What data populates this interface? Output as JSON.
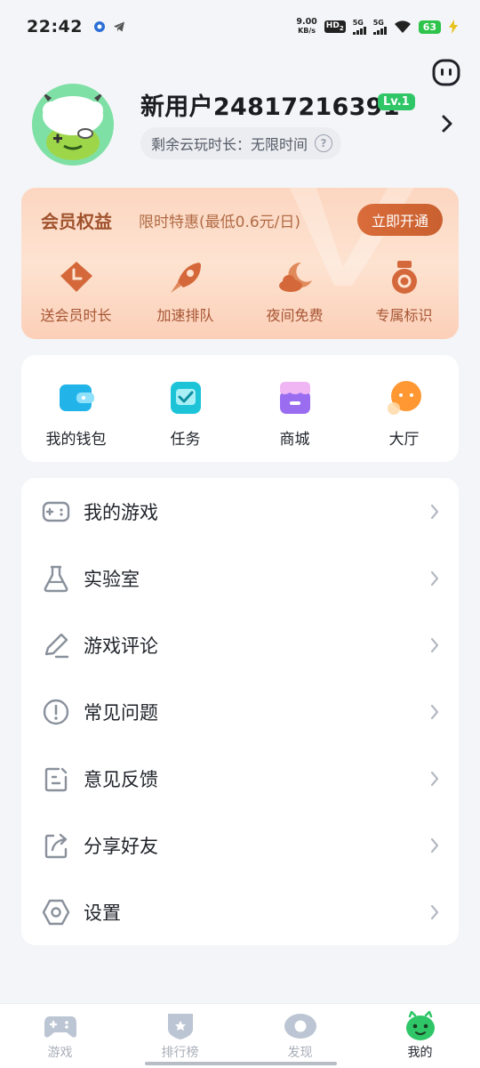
{
  "status_bar": {
    "time": "22:42",
    "net_speed_value": "9.00",
    "net_speed_unit": "KB/s",
    "hd_label": "HD",
    "sim2_label": "2",
    "signal1_label": "5G",
    "signal2_label": "5G",
    "battery": "63"
  },
  "profile": {
    "username": "新用户24817216391",
    "level": "Lv.1",
    "time_label": "剩余云玩时长：无限时间",
    "help_glyph": "?"
  },
  "vip": {
    "title": "会员权益",
    "promo": "限时特惠(最低0.6元/日)",
    "open_button": "立即开通",
    "perks": [
      {
        "label": "送会员时长",
        "icon": "clock-tag-icon"
      },
      {
        "label": "加速排队",
        "icon": "rocket-icon"
      },
      {
        "label": "夜间免费",
        "icon": "moon-cloud-icon"
      },
      {
        "label": "专属标识",
        "icon": "medal-icon"
      }
    ]
  },
  "quick": [
    {
      "label": "我的钱包",
      "icon": "wallet-icon"
    },
    {
      "label": "任务",
      "icon": "task-check-icon"
    },
    {
      "label": "商城",
      "icon": "shop-icon"
    },
    {
      "label": "大厅",
      "icon": "lobby-icon"
    }
  ],
  "menu": [
    {
      "label": "我的游戏",
      "icon": "gamepad-icon"
    },
    {
      "label": "实验室",
      "icon": "flask-icon"
    },
    {
      "label": "游戏评论",
      "icon": "pencil-icon"
    },
    {
      "label": "常见问题",
      "icon": "exclamation-icon"
    },
    {
      "label": "意见反馈",
      "icon": "feedback-icon"
    },
    {
      "label": "分享好友",
      "icon": "share-icon"
    },
    {
      "label": "设置",
      "icon": "settings-icon"
    }
  ],
  "tabs": [
    {
      "label": "游戏",
      "icon": "gamepad-tab-icon"
    },
    {
      "label": "排行榜",
      "icon": "shield-tab-icon"
    },
    {
      "label": "发现",
      "icon": "eye-tab-icon"
    },
    {
      "label": "我的",
      "icon": "monster-tab-icon"
    }
  ],
  "colors": {
    "brand_green": "#2fc667",
    "vip_orange": "#d96c3a",
    "page_bg": "#f4f5f8"
  }
}
